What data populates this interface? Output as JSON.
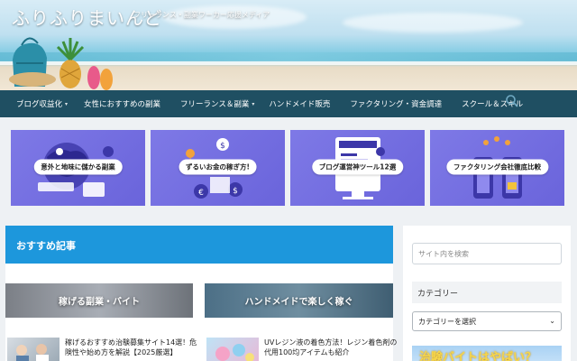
{
  "header": {
    "site_title": "ふりふりまいんど",
    "tagline": "フリーランス・副業ワーカー応援メディア"
  },
  "nav": {
    "items": [
      {
        "label": "ブログ収益化",
        "has_dropdown": true
      },
      {
        "label": "女性におすすめの副業",
        "has_dropdown": false
      },
      {
        "label": "フリーランス＆副業",
        "has_dropdown": true
      },
      {
        "label": "ハンドメイド販売",
        "has_dropdown": false
      },
      {
        "label": "ファクタリング・資金調達",
        "has_dropdown": false
      },
      {
        "label": "スクール＆スキル",
        "has_dropdown": false
      }
    ],
    "search_icon": "search-icon"
  },
  "banners": [
    {
      "label": "意外と地味に儲かる副業"
    },
    {
      "label": "ずるいお金の稼ぎ方!"
    },
    {
      "label": "ブログ運営神ツール12選"
    },
    {
      "label": "ファクタリング会社徹底比較"
    }
  ],
  "main": {
    "section_title": "おすすめ記事",
    "categories": [
      {
        "label": "稼げる副業・バイト"
      },
      {
        "label": "ハンドメイドで楽しく稼ぐ"
      }
    ],
    "posts": [
      {
        "title": "稼げるおすすめ治験募集サイト14選！危険性や始め方を解説【2025厳選】"
      },
      {
        "title": "UVレジン液の着色方法！レジン着色剤の代用100均アイテムも紹介"
      }
    ]
  },
  "sidebar": {
    "search_placeholder": "サイト内を検索",
    "category_heading": "カテゴリー",
    "category_select": "カテゴリーを選択",
    "ad_text": "治験バイトはやばい？"
  },
  "colors": {
    "nav_bg": "#1f4f62",
    "section_blue": "#1d97dc",
    "banner_purple": "#7e79e6"
  }
}
